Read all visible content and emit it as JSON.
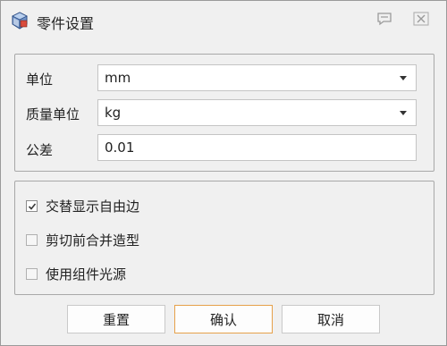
{
  "window": {
    "title": "零件设置",
    "icon": "part-settings-app-icon"
  },
  "titlebar_buttons": {
    "help_icon": "chat-bubble-icon",
    "close_icon": "close-icon"
  },
  "units": {
    "unit_label": "单位",
    "unit_value": "mm",
    "mass_unit_label": "质量单位",
    "mass_unit_value": "kg",
    "tolerance_label": "公差",
    "tolerance_value": "0.01"
  },
  "options": [
    {
      "label": "交替显示自由边",
      "checked": true
    },
    {
      "label": "剪切前合并造型",
      "checked": false
    },
    {
      "label": "使用组件光源",
      "checked": false
    }
  ],
  "buttons": {
    "reset": "重置",
    "confirm": "确认",
    "cancel": "取消"
  },
  "colors": {
    "primary_button_border": "#e6a14a",
    "background": "#f0f0f0"
  }
}
